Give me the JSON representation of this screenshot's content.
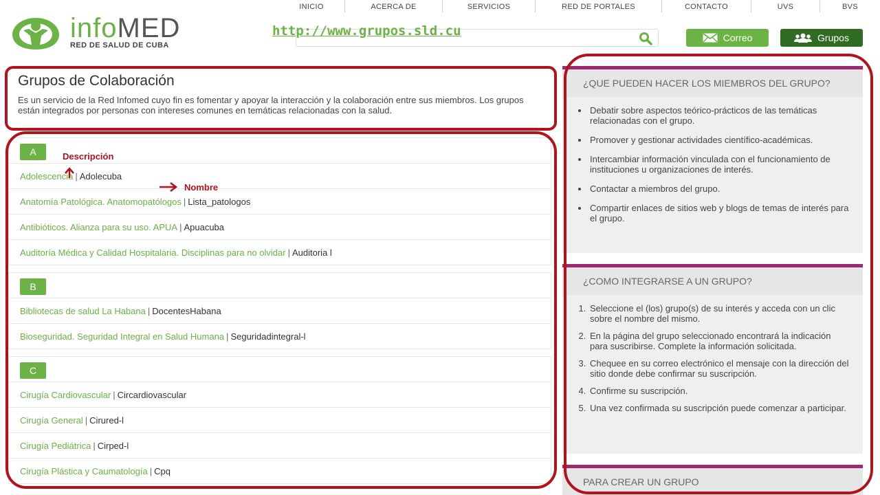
{
  "topnav": [
    "INICIO",
    "ACERCA DE",
    "SERVICIOS",
    "RED DE PORTALES",
    "CONTACTO",
    "UVS",
    "BVS"
  ],
  "logo": {
    "name_prefix": "info",
    "name_suffix": "MED",
    "sub": "RED DE SALUD DE CUBA"
  },
  "url": "http://www.grupos.sld.cu",
  "search": {
    "placeholder": ""
  },
  "buttons": {
    "correo": "Correo",
    "grupos": "Grupos"
  },
  "intro": {
    "title": "Grupos de Colaboración",
    "text": "Es un servicio de la Red Infomed cuyo fin es fomentar y apoyar la interacción y la colaboración entre sus miembros. Los grupos están integrados por personas con intereses comunes en temáticas relacionadas con la salud."
  },
  "annotations": {
    "description": "Descripción",
    "name": "Nombre"
  },
  "letters": [
    {
      "letter": "A",
      "groups": [
        {
          "desc": "Adolescencia",
          "name": "Adolecuba"
        },
        {
          "desc": "Anatomía Patológica. Anatomopatólogos",
          "name": "Lista_patologos"
        },
        {
          "desc": "Antibióticos. Alianza para su uso. APUA",
          "name": "Apuacuba"
        },
        {
          "desc": "Auditoría Médica y Calidad Hospitalaria. Disciplinas para no olvidar",
          "name": "Auditoria l"
        }
      ]
    },
    {
      "letter": "B",
      "groups": [
        {
          "desc": "Bibliotecas de salud La Habana",
          "name": "DocentesHabana"
        },
        {
          "desc": "Bioseguridad. Seguridad Integral en Salud Humana",
          "name": "Seguridadintegral-l"
        }
      ]
    },
    {
      "letter": "C",
      "groups": [
        {
          "desc": "Cirugía Cardiovascular",
          "name": "Circardiovascular"
        },
        {
          "desc": "Cirugía General",
          "name": "Cirured-l"
        },
        {
          "desc": "Cirugía Pediátrica",
          "name": "Cirped-l"
        },
        {
          "desc": "Cirugía Plástica y Caumatología",
          "name": "Cpq"
        }
      ]
    }
  ],
  "sidebar": {
    "card1": {
      "title": "¿QUE PUEDEN HACER LOS MIEMBROS DEL GRUPO?",
      "items": [
        "Debatir sobre aspectos teórico-prácticos de las temáticas relacionadas con el grupo.",
        "Promover y gestionar actividades científico-académicas.",
        "Intercambiar información vinculada con el funcionamiento de instituciones u organizaciones de interés.",
        "Contactar a miembros del grupo.",
        "Compartir enlaces de sitios web y blogs de temas de interés para el grupo."
      ]
    },
    "card2": {
      "title": "¿COMO INTEGRARSE A UN GRUPO?",
      "items": [
        "Seleccione el (los) grupo(s) de su interés y acceda con un clic sobre el nombre del mismo.",
        "En la página del grupo seleccionado encontrará la indicación para suscribirse. Complete la información solicitada.",
        "Chequee en su correo electrónico el mensaje con la dirección del sitio donde debe confirmar su suscripción.",
        "Confirme su suscripción.",
        "Una vez confirmada su suscripción puede comenzar a participar."
      ]
    },
    "card3": {
      "title": "PARA CREAR UN GRUPO"
    }
  },
  "colors": {
    "green": "#6ab344",
    "dark_green": "#2f6b22",
    "purple": "#9e2a6e",
    "annotation_red": "#b4121b"
  }
}
